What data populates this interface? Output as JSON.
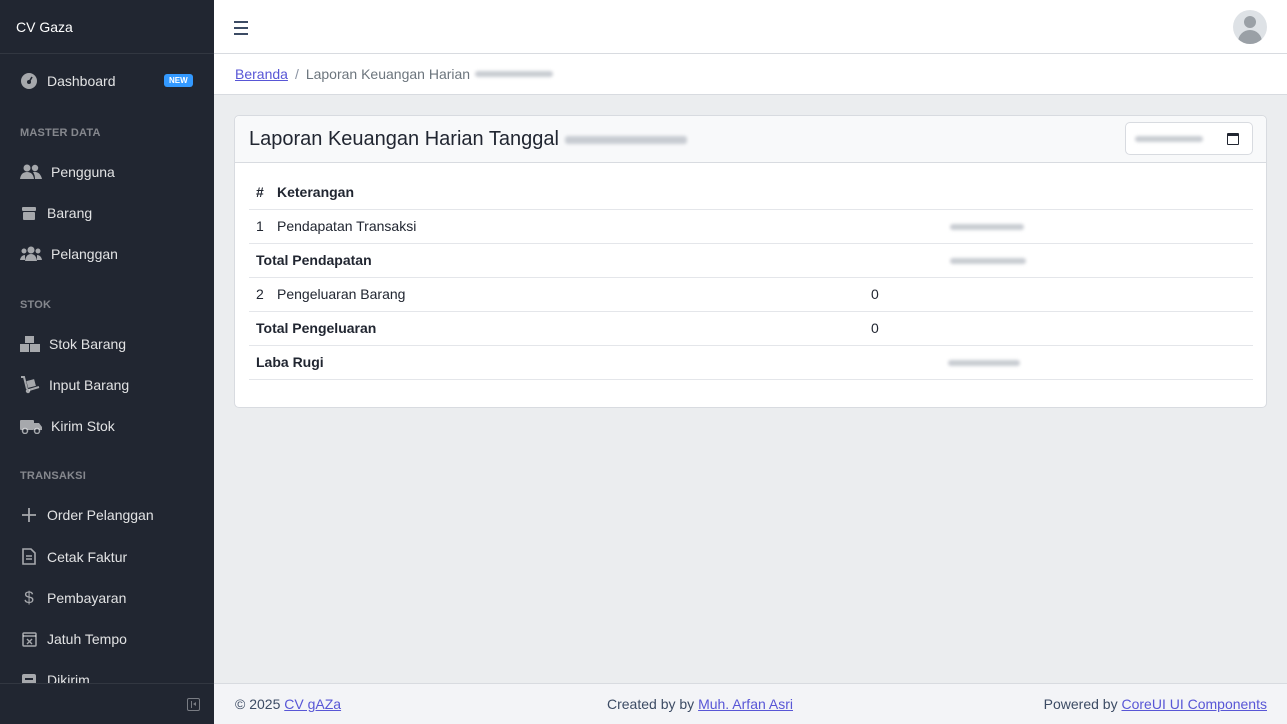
{
  "sidebar": {
    "brand": "CV Gaza",
    "dashboard": {
      "label": "Dashboard",
      "badge": "NEW"
    },
    "sections": {
      "master": "MASTER DATA",
      "stok": "STOK",
      "transaksi": "TRANSAKSI"
    },
    "items": {
      "pengguna": "Pengguna",
      "barang": "Barang",
      "pelanggan": "Pelanggan",
      "stok_barang": "Stok Barang",
      "input_barang": "Input Barang",
      "kirim_stok": "Kirim Stok",
      "order_pelanggan": "Order Pelanggan",
      "cetak_faktur": "Cetak Faktur",
      "pembayaran": "Pembayaran",
      "jatuh_tempo": "Jatuh Tempo",
      "dikirim": "Dikirim"
    }
  },
  "breadcrumb": {
    "home": "Beranda",
    "current": "Laporan Keuangan Harian"
  },
  "card": {
    "title": "Laporan Keuangan Harian Tanggal"
  },
  "table": {
    "headers": {
      "num": "#",
      "desc": "Keterangan"
    },
    "rows": {
      "r1": {
        "num": "1",
        "desc": "Pendapatan Transaksi"
      },
      "r2": {
        "desc": "Total Pendapatan"
      },
      "r3": {
        "num": "2",
        "desc": "Pengeluaran Barang",
        "value": "0"
      },
      "r4": {
        "desc": "Total Pengeluaran",
        "value": "0"
      },
      "r5": {
        "desc": "Laba Rugi"
      }
    }
  },
  "footer": {
    "copyright": "© 2025",
    "company_link": "CV gAZa",
    "created_by": "Created by by",
    "author_link": "Muh. Arfan Asri",
    "powered_by": "Powered by",
    "powered_link": "CoreUI UI Components"
  }
}
